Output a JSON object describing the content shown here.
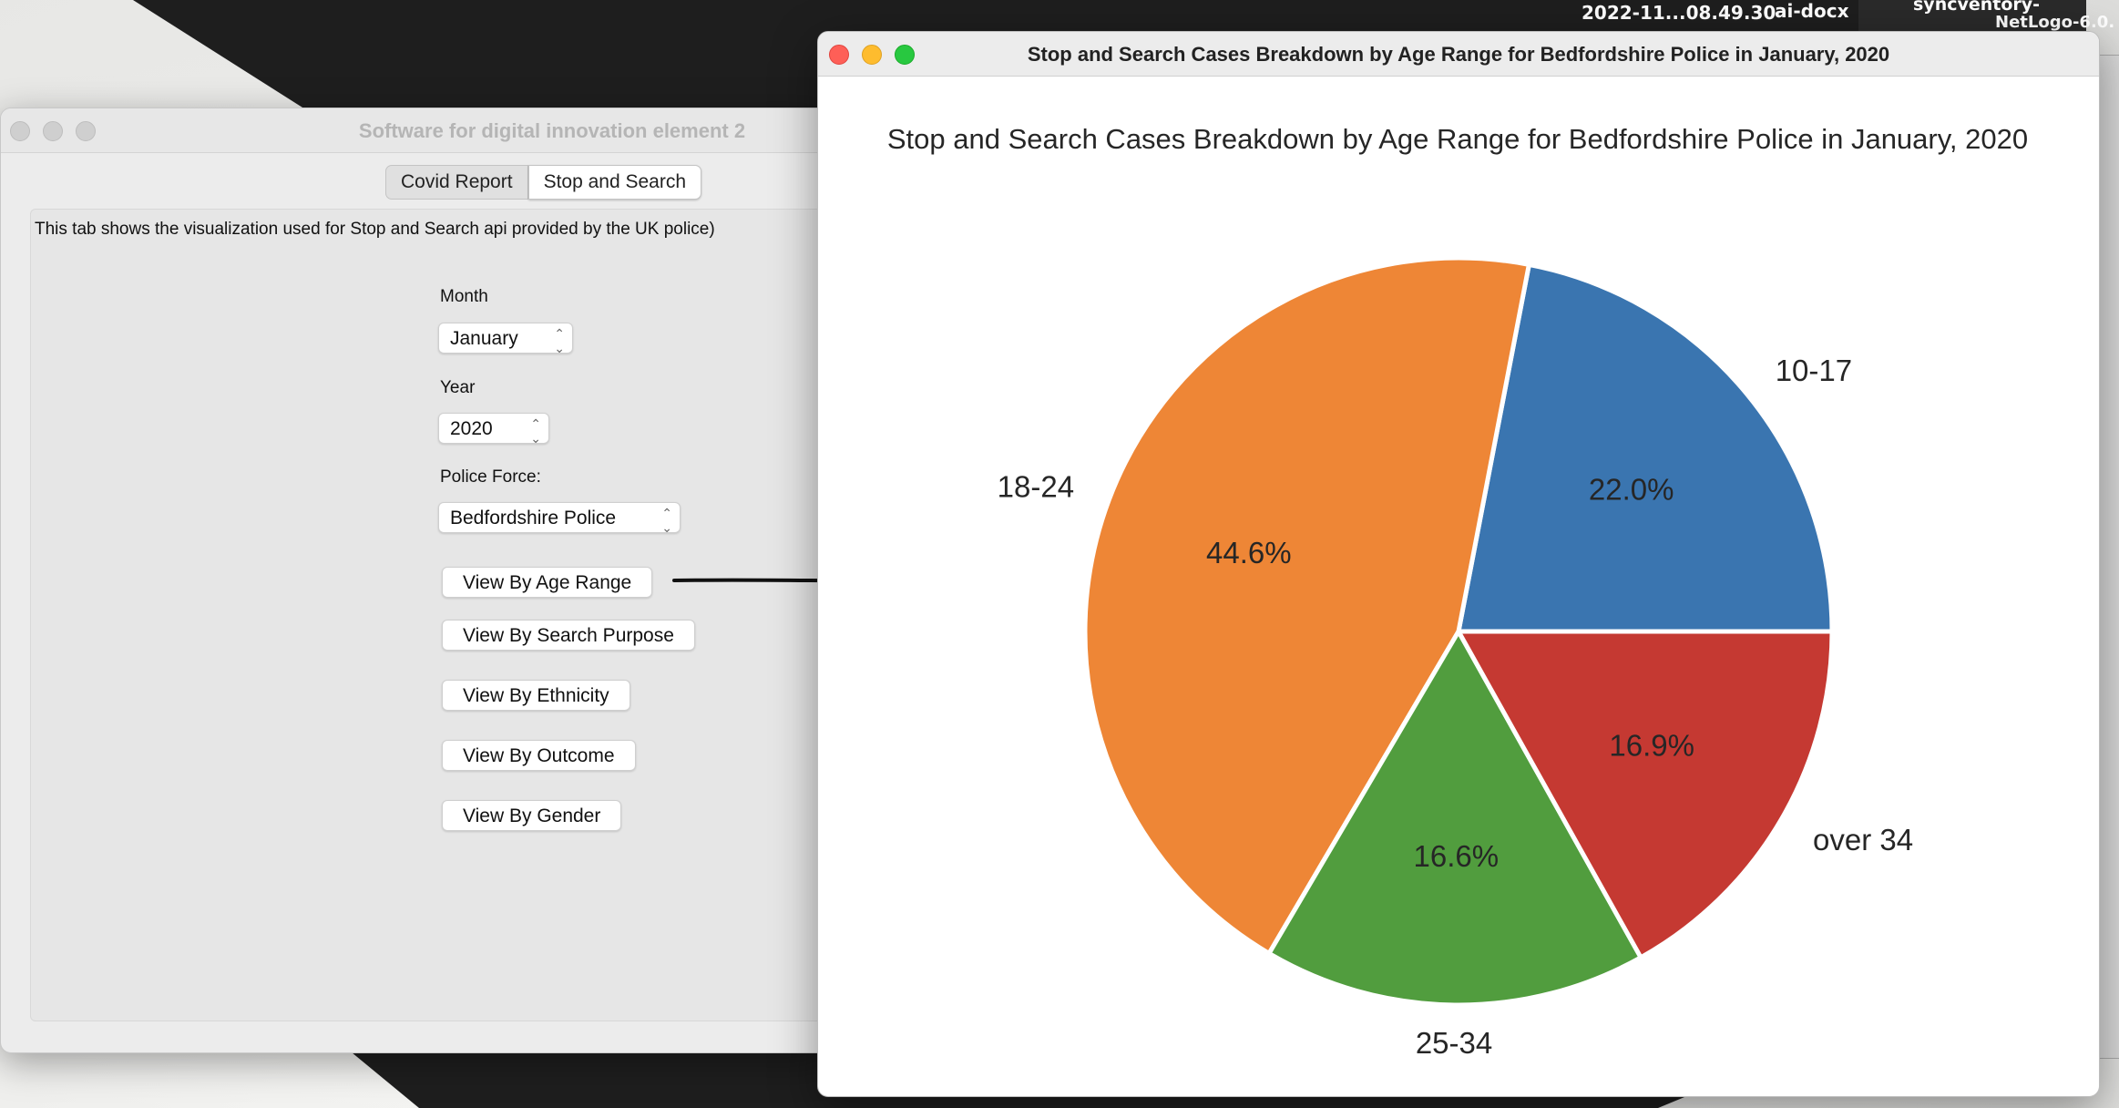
{
  "desktop": {
    "menubar_items": [
      "2022-11...08.49.30",
      "ai-docx",
      "syncventory-",
      "NetLogo-6.0."
    ]
  },
  "left_window": {
    "title": "Software for digital innovation element 2",
    "tabs": [
      {
        "label": "Covid Report",
        "selected": false
      },
      {
        "label": "Stop and Search",
        "selected": true
      }
    ],
    "description": "This tab shows the visualization used for Stop and Search api provided by the UK police)",
    "month": {
      "label": "Month",
      "value": "January"
    },
    "year": {
      "label": "Year",
      "value": "2020"
    },
    "police_force": {
      "label": "Police Force:",
      "value": "Bedfordshire Police"
    },
    "buttons": {
      "age": "View By Age Range",
      "purpose": "View By Search Purpose",
      "ethnicity": "View By Ethnicity",
      "outcome": "View By Outcome",
      "gender": "View By Gender"
    }
  },
  "right_window": {
    "title": "Stop and Search Cases Breakdown by Age Range for Bedfordshire Police in January, 2020"
  },
  "chart_data": {
    "type": "pie",
    "title": "Stop and Search Cases Breakdown by Age Range for Bedfordshire Police in January, 2020",
    "categories": [
      "10-17",
      "18-24",
      "25-34",
      "over 34"
    ],
    "values": [
      22.0,
      44.6,
      16.6,
      16.9
    ],
    "value_labels": [
      "22.0%",
      "44.6%",
      "16.6%",
      "16.9%"
    ],
    "colors": [
      "#3a75b0",
      "#ee8636",
      "#519d3e",
      "#c53932"
    ],
    "start_angle_deg": 0,
    "direction": "counterclockwise"
  }
}
